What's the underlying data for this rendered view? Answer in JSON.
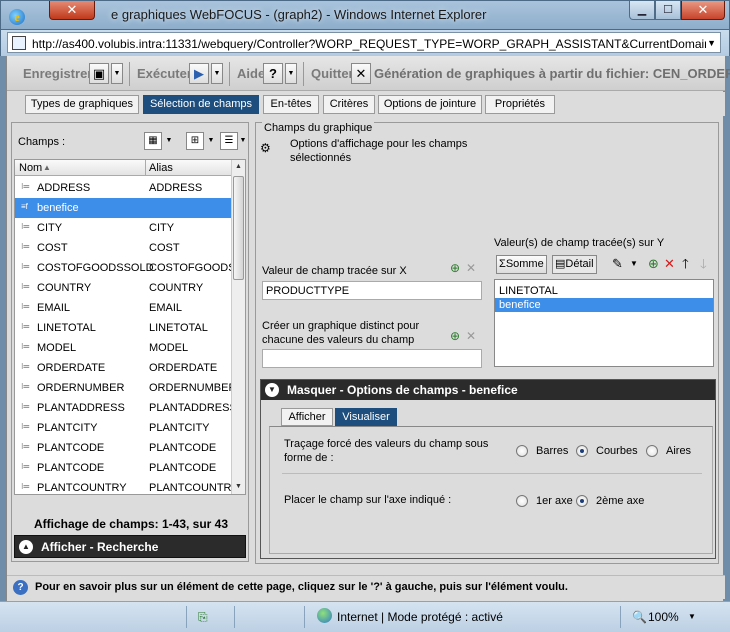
{
  "window": {
    "title_prefix": "e graphiques WebFOCUS - (graph2) - Windows Internet Explorer",
    "close_glyph": "✕",
    "min_glyph": "▁",
    "max_glyph": "☐"
  },
  "address": {
    "url": "http://as400.volubis.intra:11331/webquery/Controller?WORP_REQUEST_TYPE=WORP_GRAPH_ASSISTANT&CurrentDomain=ur"
  },
  "toolbar": {
    "save_label": "Enregistrer",
    "run_label": "Exécuter",
    "help_label": "Aide",
    "help_glyph": "?",
    "quit_label": "Quitter",
    "quit_glyph": "✕",
    "title": "Génération de graphiques à partir du fichier: CEN_ORDERS"
  },
  "tabs": [
    {
      "label": "Types de graphiques"
    },
    {
      "label": "Sélection de champs"
    },
    {
      "label": "En-têtes"
    },
    {
      "label": "Critères"
    },
    {
      "label": "Options de jointure"
    },
    {
      "label": "Propriétés"
    }
  ],
  "left": {
    "champs_label": "Champs :",
    "col_nom": "Nom",
    "col_alias": "Alias",
    "fields": [
      {
        "nom": "ADDRESS",
        "alias": "ADDRESS"
      },
      {
        "nom": "benefice",
        "alias": ""
      },
      {
        "nom": "CITY",
        "alias": "CITY"
      },
      {
        "nom": "COST",
        "alias": "COST"
      },
      {
        "nom": "COSTOFGOODSSOLD",
        "alias": "COSTOFGOODSS"
      },
      {
        "nom": "COUNTRY",
        "alias": "COUNTRY"
      },
      {
        "nom": "EMAIL",
        "alias": "EMAIL"
      },
      {
        "nom": "LINETOTAL",
        "alias": "LINETOTAL"
      },
      {
        "nom": "MODEL",
        "alias": "MODEL"
      },
      {
        "nom": "ORDERDATE",
        "alias": "ORDERDATE"
      },
      {
        "nom": "ORDERNUMBER",
        "alias": "ORDERNUMBER"
      },
      {
        "nom": "PLANTADDRESS",
        "alias": "PLANTADDRESS"
      },
      {
        "nom": "PLANTCITY",
        "alias": "PLANTCITY"
      },
      {
        "nom": "PLANTCODE",
        "alias": "PLANTCODE"
      },
      {
        "nom": "PLANTCODE",
        "alias": "PLANTCODE"
      },
      {
        "nom": "PLANTCOUNTRY",
        "alias": "PLANTCOUNTRY"
      }
    ],
    "count": "Affichage de champs: 1-43, sur 43",
    "search_label": "Afficher - Recherche"
  },
  "right": {
    "group_title": "Champs du graphique",
    "options_label": "Options d'affichage pour les champs sélectionnés",
    "x_label": "Valeur de champ tracée sur X",
    "x_value": "PRODUCTTYPE",
    "distinct_label": "Créer un graphique distinct pour chacune des valeurs du champ",
    "distinct_value": "",
    "y_label": "Valeur(s) de champ tracée(s) sur Y",
    "somme_label": "Somme",
    "detail_label": "Détail",
    "y_values": [
      "LINETOTAL",
      "benefice"
    ],
    "masquer_label": "Masquer - Options de champs - benefice",
    "subtabs": [
      {
        "label": "Afficher"
      },
      {
        "label": "Visualiser"
      }
    ],
    "trace_label": "Traçage forcé des valeurs du champ sous forme de :",
    "trace_options": [
      "Barres",
      "Courbes",
      "Aires"
    ],
    "trace_selected": "Courbes",
    "axe_label": "Placer le champ sur l'axe indiqué :",
    "axe_options": [
      "1er axe",
      "2ème axe"
    ],
    "axe_selected": "2ème axe"
  },
  "help_text": "Pour en savoir plus sur un élément de cette page, cliquez sur le '?' à gauche, puis sur l'élément voulu.",
  "status": {
    "zone": "Internet | Mode protégé : activé",
    "zoom": "100%"
  }
}
